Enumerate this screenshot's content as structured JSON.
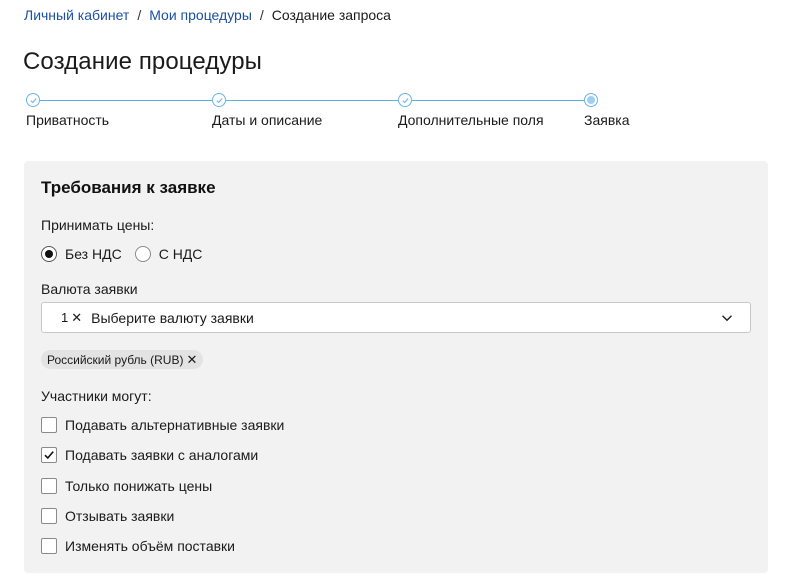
{
  "breadcrumb": {
    "items": [
      "Личный кабинет",
      "Мои процедуры"
    ],
    "separator": "/",
    "current": "Создание запроса"
  },
  "page_title": "Создание процедуры",
  "stepper": {
    "steps": [
      {
        "label": "Приватность",
        "state": "done"
      },
      {
        "label": "Даты и описание",
        "state": "done"
      },
      {
        "label": "Дополнительные поля",
        "state": "done"
      },
      {
        "label": "Заявка",
        "state": "active"
      }
    ],
    "accent_color": "#5aaee0"
  },
  "card": {
    "title": "Требования к заявке",
    "prices": {
      "label": "Принимать цены:",
      "options": [
        {
          "label": "Без НДС",
          "checked": true
        },
        {
          "label": "С НДС",
          "checked": false
        }
      ]
    },
    "currency": {
      "label": "Валюта заявки",
      "selected_count": "1",
      "count_remove": "✕",
      "placeholder": "Выберите валюту заявки",
      "chips": [
        {
          "label": "Российский рубль (RUB)",
          "remove": "✕"
        }
      ]
    },
    "participants": {
      "label": "Участники могут:",
      "options": [
        {
          "label": "Подавать альтернативные заявки",
          "checked": false
        },
        {
          "label": "Подавать заявки с аналогами",
          "checked": true
        },
        {
          "label": "Только понижать цены",
          "checked": false
        },
        {
          "label": "Отзывать заявки",
          "checked": false
        },
        {
          "label": "Изменять объём поставки",
          "checked": false
        }
      ]
    }
  },
  "colors": {
    "link": "#1d4fa3",
    "card_bg": "#f2f2f2"
  }
}
